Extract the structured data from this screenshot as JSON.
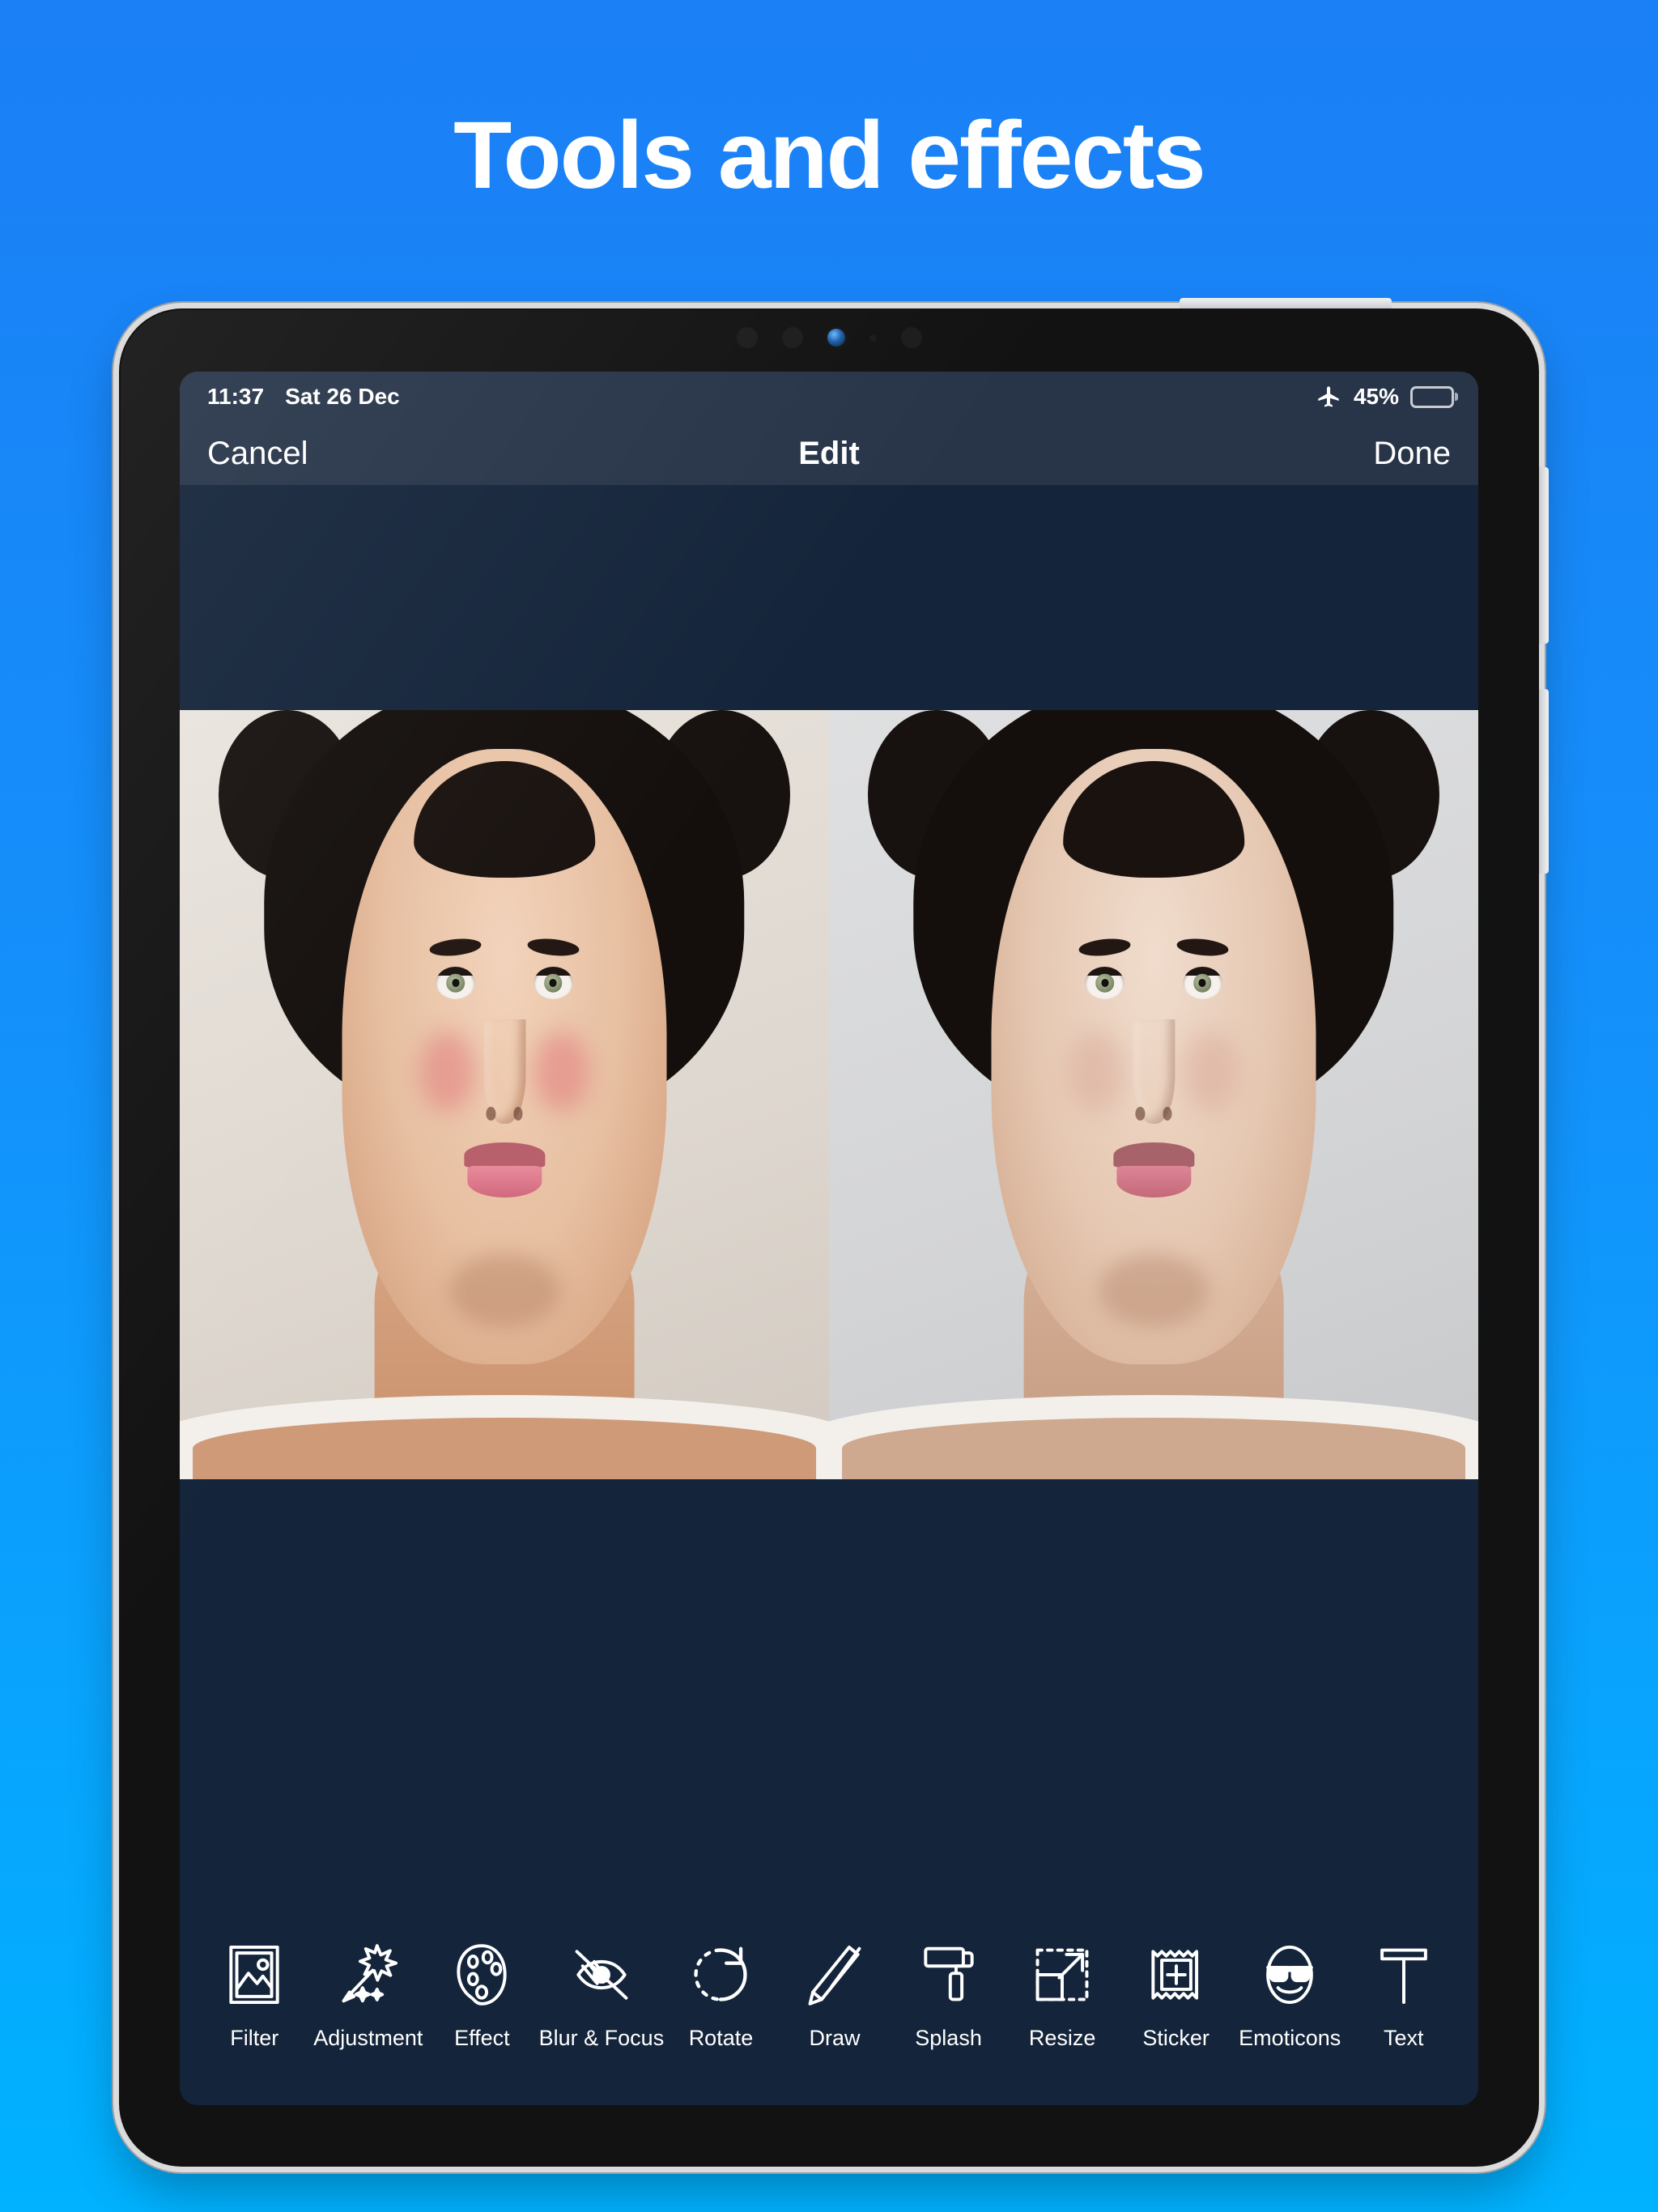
{
  "headline": "Tools and effects",
  "theme": {
    "bg_gradient_top": "#1b7ff5",
    "bg_gradient_bottom": "#00b2ff",
    "screen_bg": "#14243a",
    "bar_bg": "#283549",
    "text": "#ffffff"
  },
  "status_bar": {
    "time": "11:37",
    "date": "Sat 26 Dec",
    "airplane_icon": "airplane-icon",
    "battery_percent": "45%",
    "battery_level": 45
  },
  "nav_bar": {
    "cancel_label": "Cancel",
    "title": "Edit",
    "done_label": "Done"
  },
  "canvas": {
    "comparison": {
      "left_pane_name": "original-photo",
      "right_pane_name": "edited-photo"
    }
  },
  "toolbar": {
    "tools": [
      {
        "label": "Filter",
        "icon": "picture-frame-icon"
      },
      {
        "label": "Adjustment",
        "icon": "magic-wand-icon"
      },
      {
        "label": "Effect",
        "icon": "palette-icon"
      },
      {
        "label": "Blur & Focus",
        "icon": "eye-slash-icon"
      },
      {
        "label": "Rotate",
        "icon": "rotate-arrow-icon"
      },
      {
        "label": "Draw",
        "icon": "pencil-icon"
      },
      {
        "label": "Splash",
        "icon": "paint-roller-icon"
      },
      {
        "label": "Resize",
        "icon": "resize-arrow-icon"
      },
      {
        "label": "Sticker",
        "icon": "sticker-plus-icon"
      },
      {
        "label": "Emoticons",
        "icon": "smiley-sunglasses-icon"
      },
      {
        "label": "Text",
        "icon": "text-t-icon"
      }
    ]
  }
}
